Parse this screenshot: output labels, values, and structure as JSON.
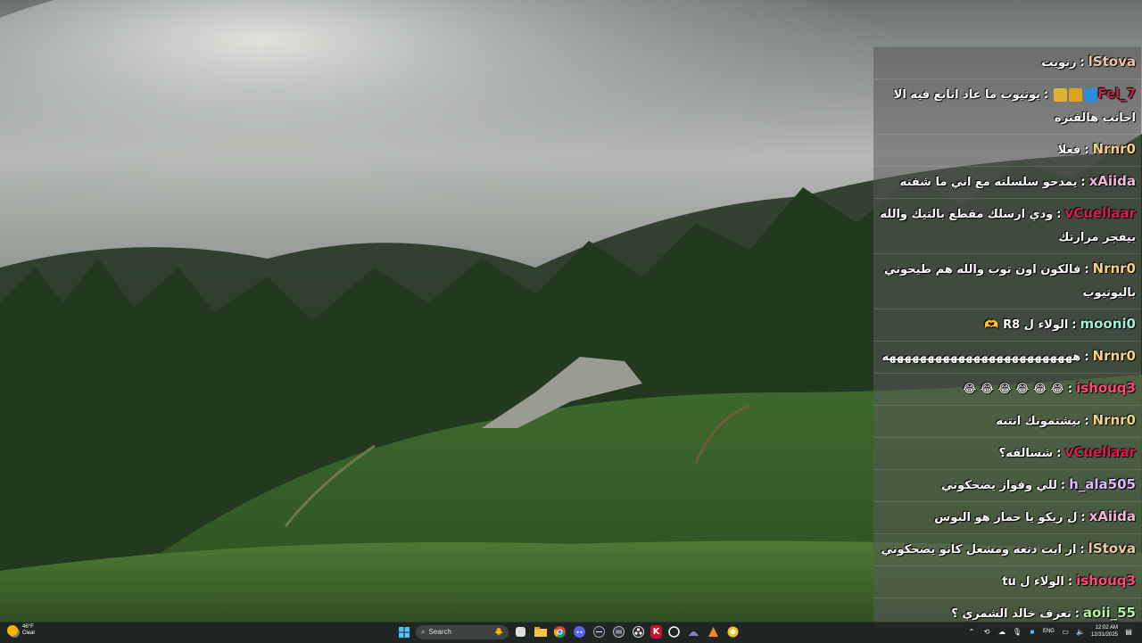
{
  "chat": {
    "messages": [
      {
        "user": "lStova",
        "color": "#f0c8a8",
        "text": "رتويت"
      },
      {
        "user": "Fel_7",
        "color": "#c0284a",
        "text": "يوتيوب ما عاد اتابع فيه الا اجانب هالفتره",
        "badges": [
          "#2a8fd8",
          "#e0a020",
          "#e0b030"
        ]
      },
      {
        "user": "Nrnr0",
        "color": "#f2d27a",
        "text": "فعلا"
      },
      {
        "user": "xAiida",
        "color": "#f2b8d6",
        "text": "يمدحو سلسلته مع اني ما شفته"
      },
      {
        "user": "vCuellaar",
        "color": "#d81e4a",
        "text": "ودي ارسلك مقطع بالتيك والله بيفجر مرارتك"
      },
      {
        "user": "Nrnr0",
        "color": "#f2d27a",
        "text": "فالكون اون توب والله هم طيحوني باليوتيوب"
      },
      {
        "user": "mooni0",
        "color": "#9ff0d8",
        "text": "الولاء ل R8 🫶"
      },
      {
        "user": "Nrnr0",
        "color": "#f2d27a",
        "text": "هههههههههههههههههههههههههه"
      },
      {
        "user": "ishouq3",
        "color": "#ff4a78",
        "text": "😂 😂 😂 😂 😂 😂"
      },
      {
        "user": "Nrnr0",
        "color": "#f2d27a",
        "text": "بيشتمونك انتبه"
      },
      {
        "user": "vCuellaar",
        "color": "#d81e4a",
        "text": "شسالفه؟"
      },
      {
        "user": "h_ala505",
        "color": "#e0b8ff",
        "text": "للي وفواز يضحكوني"
      },
      {
        "user": "xAiida",
        "color": "#f2b8d6",
        "text": "ل ريكو يا حمار هو البوس"
      },
      {
        "user": "lStova",
        "color": "#f0c8a8",
        "text": "ار ايت دنعه ومشعل كانو يضحكوني"
      },
      {
        "user": "ishouq3",
        "color": "#ff4a78",
        "text": "الولاء ل tu"
      },
      {
        "user": "aoii_55",
        "color": "#b8f0a8",
        "text": "تعرف خالد الشمري ؟"
      }
    ]
  },
  "taskbar": {
    "weather": {
      "temp": "46°F",
      "condition": "Clear"
    },
    "search_label": "Search",
    "lang": "ENG",
    "time": "12:02 AM",
    "date": "12/31/2025"
  }
}
